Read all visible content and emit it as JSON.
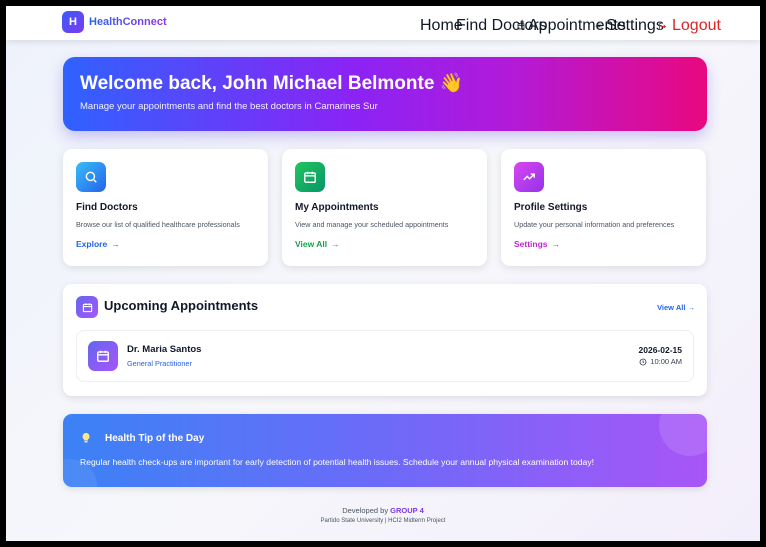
{
  "brand": {
    "logo_letter": "H",
    "name": "HealthConnect"
  },
  "nav": {
    "home": "Home",
    "find_doctors": "Find Doctors",
    "appointments": "Appointments",
    "settings": "Settings",
    "logout": "Logout"
  },
  "hero": {
    "title": "Welcome back, John Michael Belmonte 👋",
    "subtitle": "Manage your appointments and find the best doctors in Camarines Sur"
  },
  "cards": [
    {
      "title": "Find Doctors",
      "desc": "Browse our list of qualified healthcare professionals",
      "link": "Explore",
      "icon": "search-icon",
      "color": "#0ea5e9"
    },
    {
      "title": "My Appointments",
      "desc": "View and manage your scheduled appointments",
      "link": "View All",
      "icon": "calendar-icon",
      "color": "#16a34a"
    },
    {
      "title": "Profile Settings",
      "desc": "Update your personal information and preferences",
      "link": "Settings",
      "icon": "trending-up-icon",
      "color": "#c026d3"
    }
  ],
  "upcoming": {
    "title": "Upcoming Appointments",
    "view_all": "View All →",
    "appointments": [
      {
        "doctor": "Dr. Maria Santos",
        "specialty": "General Practitioner",
        "date": "2026-02-15",
        "time": "10:00 AM"
      }
    ]
  },
  "tip": {
    "title": "Health Tip of the Day",
    "text": "Regular health check-ups are important for early detection of potential health issues. Schedule your annual physical examination today!"
  },
  "footer": {
    "developed_by": "Developed by",
    "group": "GROUP 4",
    "line2": "Partido State University | HCI2 Midterm Project"
  },
  "colors": {
    "accent_blue": "#2563eb",
    "accent_purple": "#7c3aed",
    "logout_red": "#dc2626"
  }
}
